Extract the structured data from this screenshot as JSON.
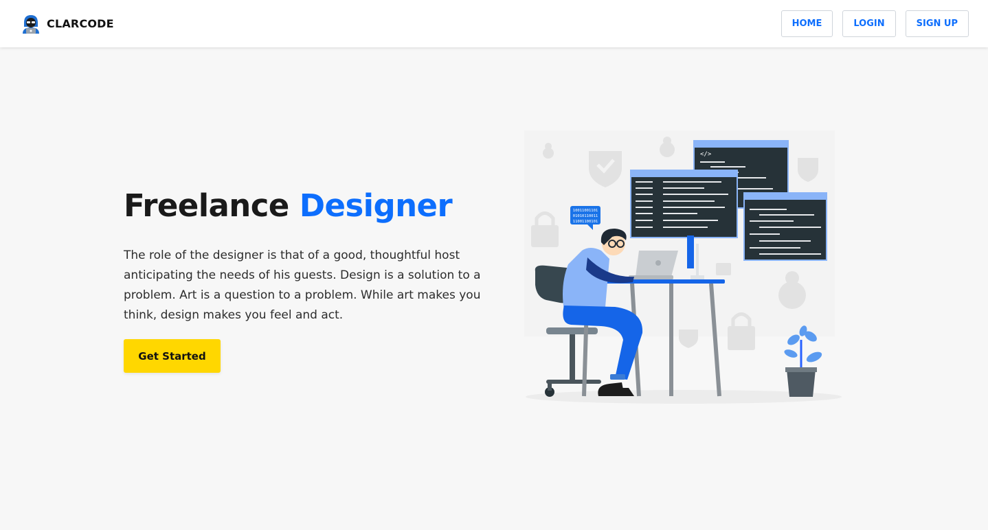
{
  "navbar": {
    "brand": {
      "name": "CLARCODE",
      "logo_icon": "hacker-avatar-icon"
    },
    "links": [
      {
        "label": "HOME"
      },
      {
        "label": "LOGIN"
      },
      {
        "label": "SIGN UP"
      }
    ]
  },
  "hero": {
    "title_part1": "Freelance",
    "title_part2": "Designer",
    "description": "The role of the designer is that of a good, thoughtful host anticipating the needs of his guests. Design is a solution to a problem. Art is a question to a problem. While art makes you think, design makes you feel and act.",
    "cta_label": "Get Started",
    "illustration": {
      "icon": "programmer-at-desk-illustration",
      "code_tag": "</>",
      "binary_bubble": [
        "10011001101",
        "01010110011",
        "11001100101"
      ]
    }
  },
  "colors": {
    "accent": "#0d6efd",
    "cta": "#ffd700",
    "background": "#f7f7f7",
    "navbar": "#ffffff"
  }
}
